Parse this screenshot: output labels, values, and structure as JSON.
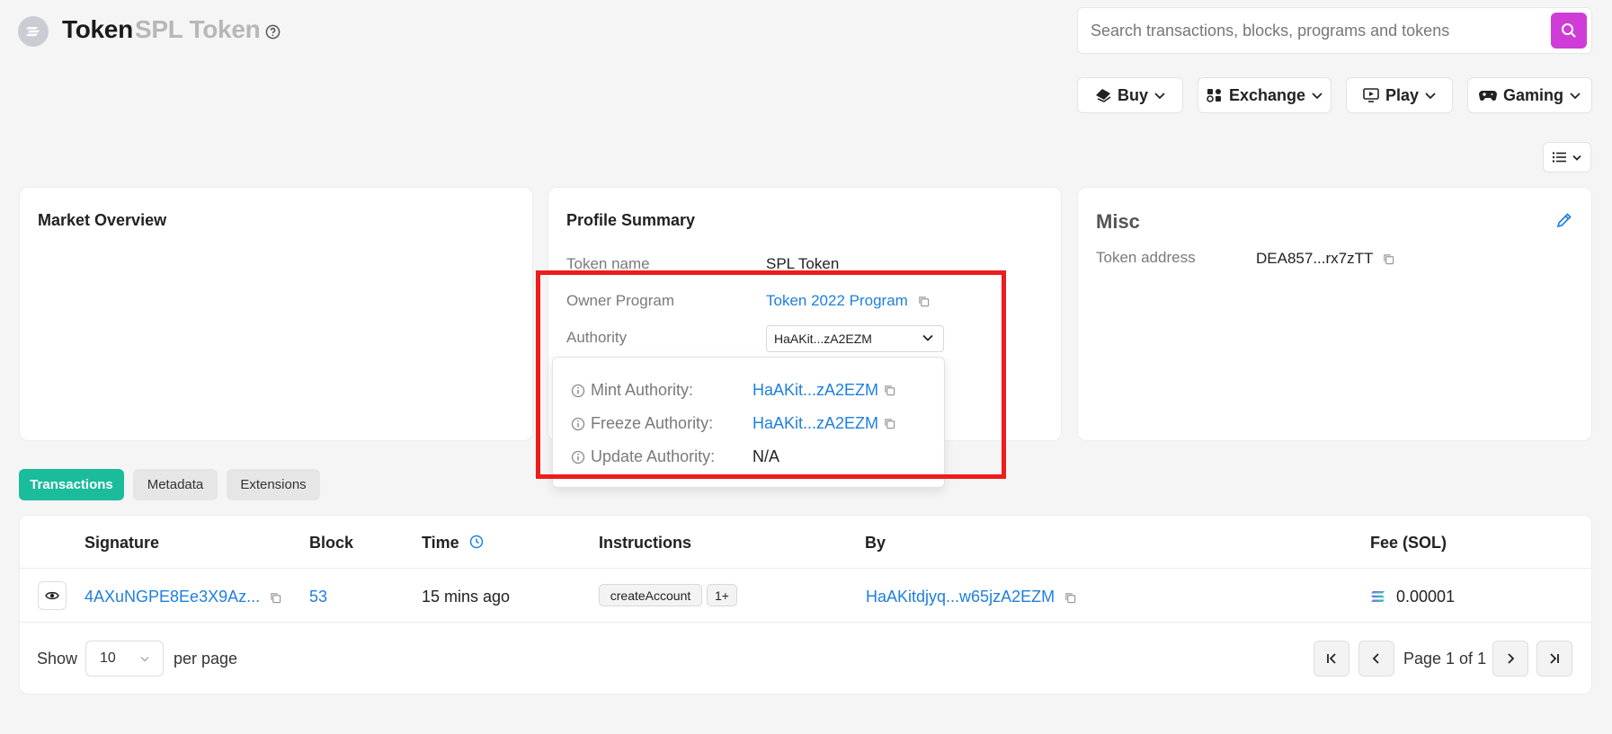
{
  "header": {
    "title": "Token",
    "subtitle": "SPL Token",
    "search_placeholder": "Search transactions, blocks, programs and tokens"
  },
  "nav": {
    "buy": "Buy",
    "exchange": "Exchange",
    "play": "Play",
    "gaming": "Gaming"
  },
  "market_overview": {
    "title": "Market Overview"
  },
  "profile_summary": {
    "title": "Profile Summary",
    "token_name_label": "Token name",
    "token_name_value": "SPL Token",
    "owner_program_label": "Owner Program",
    "owner_program_value": "Token 2022 Program",
    "authority_label": "Authority",
    "authority_selected": "HaAKit...zA2EZM"
  },
  "authority_popover": {
    "mint_label": "Mint Authority:",
    "mint_value": "HaAKit...zA2EZM",
    "freeze_label": "Freeze Authority:",
    "freeze_value": "HaAKit...zA2EZM",
    "update_label": "Update Authority:",
    "update_value": "N/A"
  },
  "misc": {
    "title": "Misc",
    "token_address_label": "Token address",
    "token_address_value": "DEA857...rx7zTT"
  },
  "tabs": {
    "transactions": "Transactions",
    "metadata": "Metadata",
    "extensions": "Extensions"
  },
  "table": {
    "headers": {
      "signature": "Signature",
      "block": "Block",
      "time": "Time",
      "instructions": "Instructions",
      "by": "By",
      "fee": "Fee (SOL)"
    },
    "row": {
      "signature": "4AXuNGPE8Ee3X9Az...",
      "block": "53",
      "time": "15 mins ago",
      "instruction": "createAccount",
      "instruction_more": "1+",
      "by": "HaAKitdjyq...w65jzA2EZM",
      "fee": "0.00001"
    }
  },
  "pagination": {
    "show_label": "Show",
    "per_page_value": "10",
    "per_page_label": "per page",
    "page_text": "Page 1 of 1"
  },
  "colors": {
    "accent_link": "#1e7fe0",
    "search_button": "#d03cd7",
    "active_tab": "#1abc9c",
    "highlight_box": "#ee1c1c"
  }
}
